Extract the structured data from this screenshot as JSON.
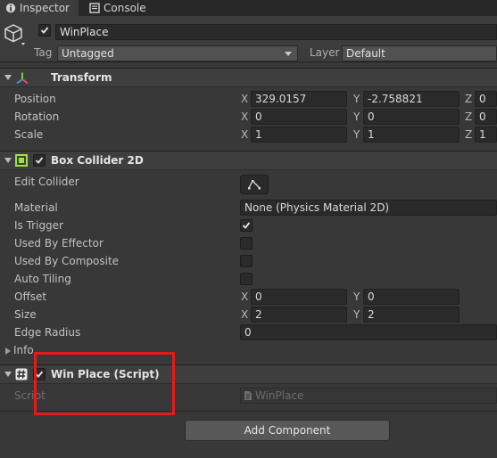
{
  "tabs": [
    {
      "label": "Inspector",
      "icon": "info-icon"
    },
    {
      "label": "Console",
      "icon": "console-icon"
    }
  ],
  "gameobject": {
    "name": "WinPlace",
    "tag_label": "Tag",
    "tag_value": "Untagged",
    "layer_label": "Layer",
    "layer_value": "Default"
  },
  "transform": {
    "title": "Transform",
    "rows": [
      {
        "label": "Position",
        "x": "329.0157",
        "y": "-2.758821",
        "z": "0"
      },
      {
        "label": "Rotation",
        "x": "0",
        "y": "0",
        "z": "0"
      },
      {
        "label": "Scale",
        "x": "1",
        "y": "1",
        "z": "1"
      }
    ],
    "axes": [
      "X",
      "Y",
      "Z"
    ]
  },
  "box_collider": {
    "title": "Box Collider 2D",
    "edit_collider_label": "Edit Collider",
    "material_label": "Material",
    "material_value": "None (Physics Material 2D)",
    "is_trigger_label": "Is Trigger",
    "is_trigger": true,
    "used_by_effector_label": "Used By Effector",
    "used_by_composite_label": "Used By Composite",
    "auto_tiling_label": "Auto Tiling",
    "offset_label": "Offset",
    "offset": {
      "x": "0",
      "y": "0"
    },
    "size_label": "Size",
    "size": {
      "x": "2",
      "y": "2"
    },
    "edge_radius_label": "Edge Radius",
    "edge_radius": "0",
    "info_label": "Info"
  },
  "script_component": {
    "title": "Win Place (Script)",
    "script_label": "Script",
    "script_value": "WinPlace"
  },
  "add_component_label": "Add Component",
  "colors": {
    "background": "#383838",
    "highlight_rect": "#e8181a",
    "collider_icon": "#9ce33f"
  }
}
